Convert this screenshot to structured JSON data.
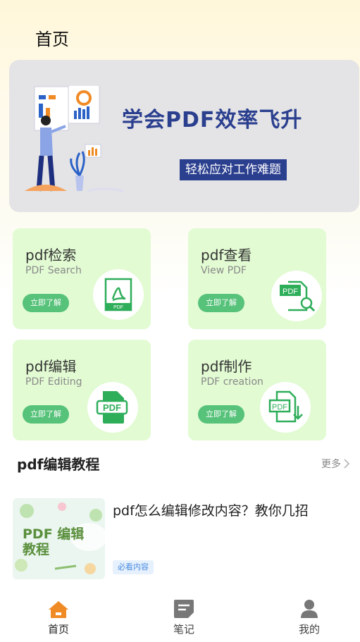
{
  "header": {
    "title": "首页"
  },
  "banner": {
    "title": "学会PDF效率飞升",
    "tag": "轻松应对工作难题"
  },
  "features": [
    {
      "title": "pdf检索",
      "subtitle": "PDF Search",
      "button": "立即了解",
      "icon": "pdf-acrobat-icon"
    },
    {
      "title": "pdf查看",
      "subtitle": "View PDF",
      "button": "立即了解",
      "icon": "pdf-search-icon"
    },
    {
      "title": "pdf编辑",
      "subtitle": "PDF Editing",
      "button": "立即了解",
      "icon": "pdf-file-icon"
    },
    {
      "title": "pdf制作",
      "subtitle": "PDF creation",
      "button": "立即了解",
      "icon": "pdf-download-icon"
    }
  ],
  "section": {
    "title": "pdf编辑教程",
    "more": "更多"
  },
  "article": {
    "thumb_text": "PDF 编辑教程",
    "title": "pdf怎么编辑修改内容？教你几招",
    "tag": "必看内容"
  },
  "tabs": [
    {
      "label": "首页",
      "icon": "home-icon",
      "active": true
    },
    {
      "label": "笔记",
      "icon": "note-icon",
      "active": false
    },
    {
      "label": "我的",
      "icon": "user-icon",
      "active": false
    }
  ],
  "colors": {
    "accent": "#f08a24",
    "card": "#e2fbd3",
    "button": "#57c27a",
    "banner_text": "#2b3f8f"
  }
}
